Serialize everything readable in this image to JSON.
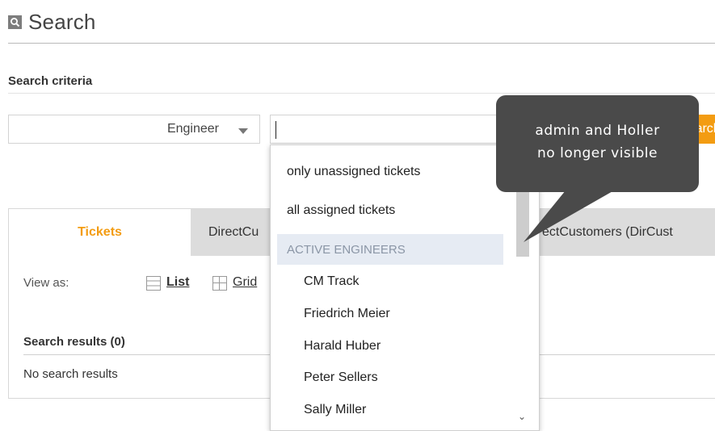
{
  "header": {
    "title": "Search",
    "icon": "search-icon"
  },
  "criteria": {
    "heading": "Search criteria",
    "field_select": "Engineer",
    "value_input": "",
    "search_button": "Search"
  },
  "tabs": [
    {
      "label": "Tickets",
      "active": true
    },
    {
      "label": "DirectCu"
    },
    {
      "label": "ectCustomers (DirCust"
    }
  ],
  "view": {
    "label": "View as:",
    "list": "List",
    "grid": "Grid"
  },
  "results": {
    "heading": "Search results (0)",
    "empty": "No search results"
  },
  "dropdown": {
    "options": [
      "only unassigned tickets",
      "all assigned tickets"
    ],
    "group_label": "ACTIVE ENGINEERS",
    "engineers": [
      "CM Track",
      "Friedrich Meier",
      "Harald Huber",
      "Peter Sellers",
      "Sally Miller"
    ]
  },
  "tooltip": {
    "line1": "admin and Holler",
    "line2": "no longer visible"
  },
  "colors": {
    "accent": "#f39c12",
    "tooltip_bg": "#4a4a4a",
    "group_bg": "#e6ebf3"
  }
}
